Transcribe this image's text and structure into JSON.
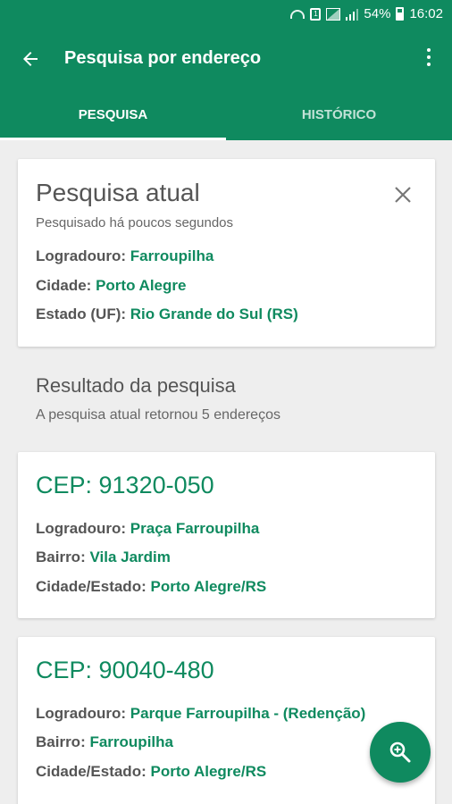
{
  "status_bar": {
    "battery": "54%",
    "time": "16:02",
    "sim_label": "1"
  },
  "toolbar": {
    "title": "Pesquisa por endereço",
    "back_icon": "arrow-back-icon",
    "menu_icon": "more-vert-icon"
  },
  "tabs": [
    {
      "label": "PESQUISA",
      "active": true
    },
    {
      "label": "HISTÓRICO",
      "active": false
    }
  ],
  "current_search": {
    "title": "Pesquisa atual",
    "subtitle": "Pesquisado há poucos segundos",
    "fields": [
      {
        "label": "Logradouro:",
        "value": "Farroupilha"
      },
      {
        "label": "Cidade:",
        "value": "Porto Alegre"
      },
      {
        "label": "Estado (UF):",
        "value": "Rio Grande do Sul (RS)"
      }
    ]
  },
  "results": {
    "title": "Resultado da pesquisa",
    "subtitle": "A pesquisa atual retornou 5 endereços",
    "items": [
      {
        "cep": "CEP: 91320-050",
        "fields": [
          {
            "label": "Logradouro:",
            "value": "Praça Farroupilha"
          },
          {
            "label": "Bairro:",
            "value": "Vila Jardim"
          },
          {
            "label": "Cidade/Estado:",
            "value": "Porto Alegre/RS"
          }
        ]
      },
      {
        "cep": "CEP: 90040-480",
        "fields": [
          {
            "label": "Logradouro:",
            "value": "Parque Farroupilha - (Redenção)"
          },
          {
            "label": "Bairro:",
            "value": "Farroupilha"
          },
          {
            "label": "Cidade/Estado:",
            "value": "Porto Alegre/RS"
          }
        ]
      }
    ]
  },
  "fab": {
    "icon": "zoom-search-icon"
  },
  "colors": {
    "primary": "#0f8a5f",
    "background": "#eeeeee",
    "card": "#ffffff"
  }
}
